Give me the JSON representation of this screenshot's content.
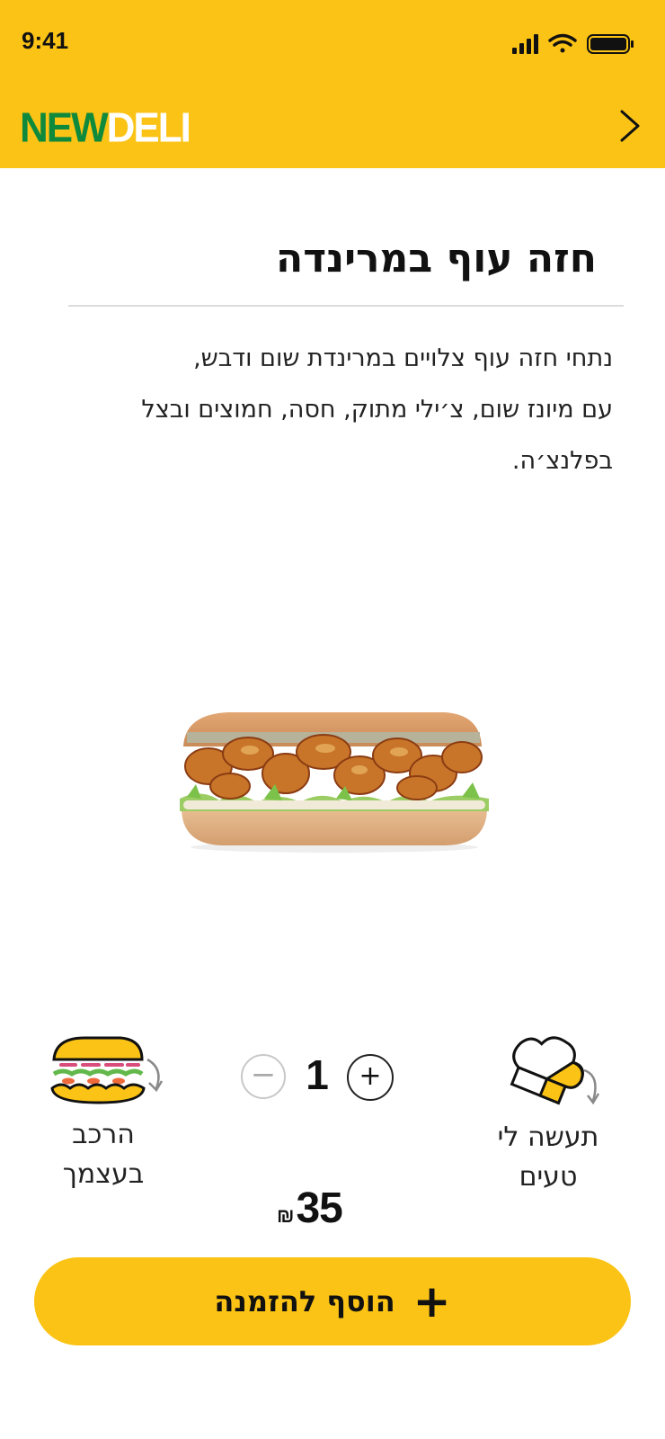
{
  "status_bar": {
    "time": "9:41"
  },
  "header": {
    "brand_new": "NEW",
    "brand_deli": "DELI",
    "nav_icon": "chevron-right-icon",
    "background": "#fbc315",
    "brand_green": "#0f8a3c"
  },
  "product": {
    "title": "חזה עוף במרינדה",
    "description_lines": [
      "נתחי חזה עוף צלויים במרינדת שום ודבש,",
      "עם מיונז שום, צ׳ילי מתוק, חסה, חמוצים ובצל",
      "בפלנצ׳ה."
    ],
    "image": "chicken-sandwich-image"
  },
  "options": {
    "custom_build_label": "הרכב בעצמך",
    "chef_choice_label": "תעשה לי טעים"
  },
  "quantity": {
    "value": "1",
    "minus": "−",
    "plus": "+"
  },
  "price": {
    "amount": "35",
    "currency": "₪"
  },
  "cta": {
    "plus": "+",
    "label": "הוסף להזמנה"
  }
}
